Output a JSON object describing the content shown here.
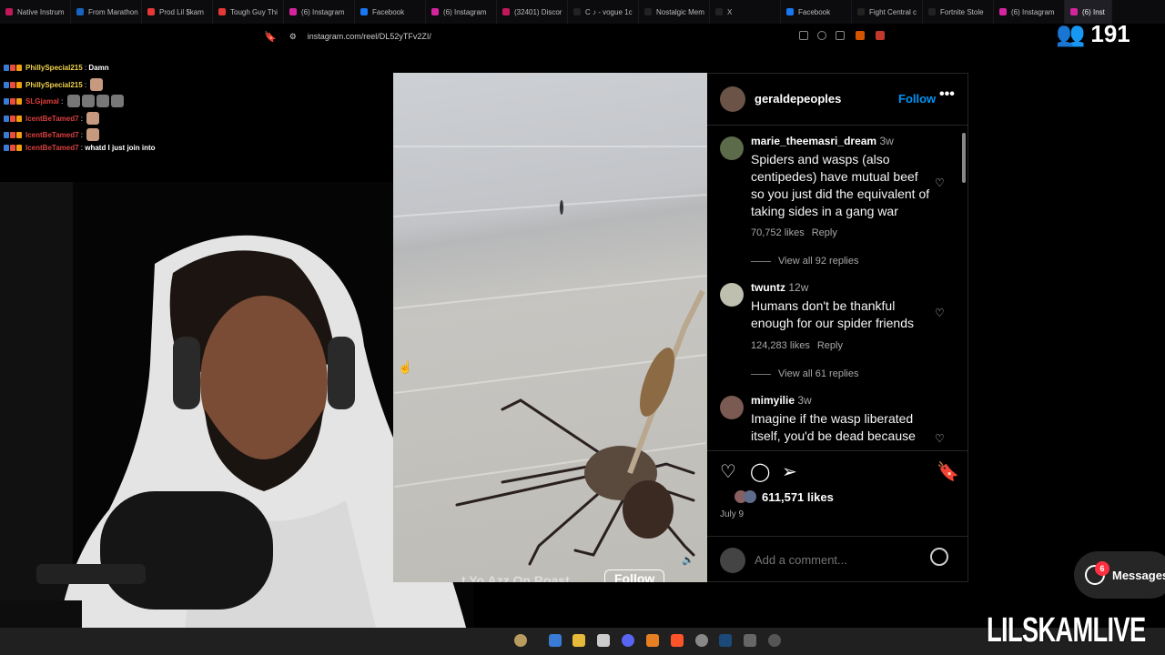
{
  "browser": {
    "tabs": [
      {
        "label": "Native Instrum",
        "color": "#c2185b"
      },
      {
        "label": "From Marathon",
        "color": "#1565c0"
      },
      {
        "label": "Prod Lil $kam",
        "color": "#e53935"
      },
      {
        "label": "Tough Guy Thi",
        "color": "#e53935"
      },
      {
        "label": "(6) Instagram",
        "color": "#d6249f"
      },
      {
        "label": "Facebook",
        "color": "#1877f2"
      },
      {
        "label": "(6) Instagram",
        "color": "#d6249f"
      },
      {
        "label": "(32401) Discor",
        "color": "#c2185b"
      },
      {
        "label": "C ♪ - vogue 1c",
        "color": "#222222"
      },
      {
        "label": "Nostalgic Mem",
        "color": "#222222"
      },
      {
        "label": "X",
        "color": "#222222"
      },
      {
        "label": "Facebook",
        "color": "#1877f2"
      },
      {
        "label": "Fight Central c",
        "color": "#222222"
      },
      {
        "label": "Fortnite Stole",
        "color": "#222222"
      },
      {
        "label": "(6) Instagram",
        "color": "#d6249f"
      },
      {
        "label": "(6) Inst",
        "color": "#d6249f",
        "active": true
      }
    ],
    "url": "instagram.com/reel/DL52yTFv2ZI/"
  },
  "stream": {
    "viewer_count": "191",
    "brand": "LILSKAMLIVE"
  },
  "chat": [
    {
      "user": "PhillySpecial215",
      "color": "#f2d24b",
      "message": "Damn"
    },
    {
      "user": "PhillySpecial215",
      "color": "#f2d24b",
      "message": ""
    },
    {
      "user": "SLGjamal",
      "color": "#e23a3a",
      "message": ""
    },
    {
      "user": "IcentBeTamed7",
      "color": "#d94040",
      "message": ""
    },
    {
      "user": "IcentBeTamed7",
      "color": "#d94040",
      "message": ""
    },
    {
      "user": "IcentBeTamed7",
      "color": "#d94040",
      "message": "whatd I just join into"
    }
  ],
  "reel": {
    "caption": "t Yo Azz On Roast",
    "follow": "Follow"
  },
  "post": {
    "author": "geraldepeoples",
    "follow": "Follow",
    "more": "•••",
    "comments": [
      {
        "user": "marie_theemasri_dream",
        "age": "3w",
        "text": "Spiders and wasps (also centipedes) have mutual beef so you just did the equivalent of taking sides in a gang war",
        "likes": "70,752 likes",
        "reply": "Reply",
        "replies": "View all 92 replies"
      },
      {
        "user": "twuntz",
        "age": "12w",
        "text": "Humans don't be thankful enough for our spider friends",
        "likes": "124,283 likes",
        "reply": "Reply",
        "replies": "View all 61 replies"
      },
      {
        "user": "mimyilie",
        "age": "3w",
        "text": "Imagine if the wasp liberated itself, you'd be dead because",
        "likes": "",
        "reply": "",
        "replies": ""
      }
    ],
    "likes": "611,571 likes",
    "date": "July 9",
    "comment_placeholder": "Add a comment..."
  },
  "messages": {
    "label": "Messages",
    "badge": "6"
  }
}
